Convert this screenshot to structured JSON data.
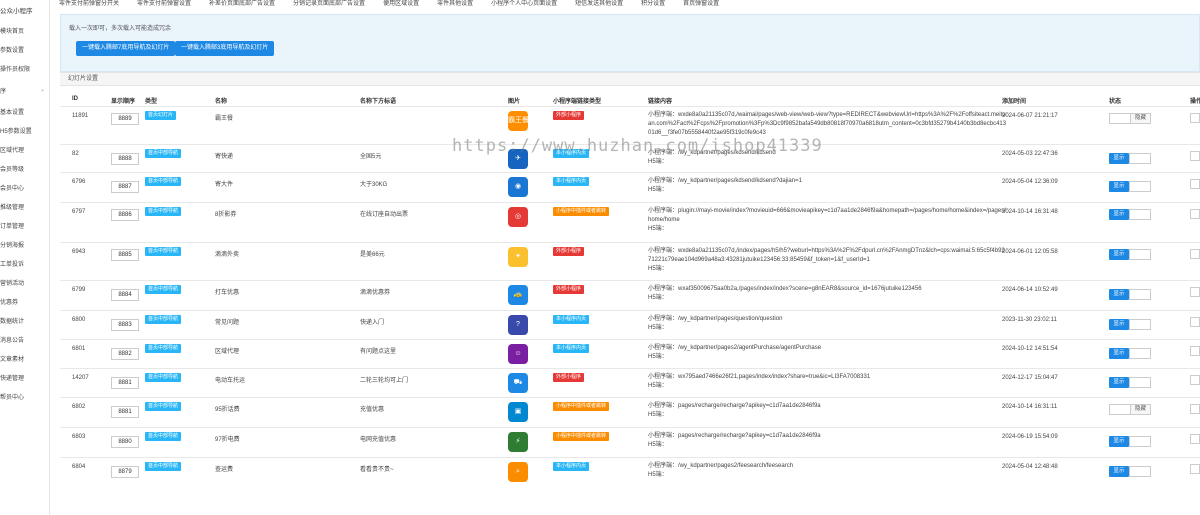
{
  "sidebar": {
    "brand": "公众小程序",
    "items": [
      "模块首页",
      "参数设置",
      "操作员权限"
    ],
    "group": "序",
    "sub_items": [
      "基本设置",
      "H5参数设置",
      "区域代理",
      "会员等级",
      "会员中心",
      "推级管理",
      "订单管理",
      "分销海报",
      "工单投诉",
      "营销活动",
      "优惠券",
      "数据统计",
      "消息公告",
      "文章素材",
      "快递管理",
      "帮员中心"
    ]
  },
  "top_tabs": [
    "零件支付前弹窗分开关",
    "零件支付前弹窗设置",
    "补差价页面底部广告设置",
    "分销记录页面底部广告设置",
    "便用区域设置",
    "零件其他设置",
    "小程序个人中心页面设置",
    "短信发送其他设置",
    "积分设置",
    "首页弹窗设置"
  ],
  "notice": {
    "message": "载入一次即可，多次载入可能造成冗余",
    "button1": "一键载入腾邮7底用导航及幻灯片",
    "button2": "一键载入腾邮3底用导航及幻灯片"
  },
  "section_title": "幻灯片设置",
  "columns": [
    "ID",
    "显示顺序",
    "类型",
    "名称",
    "名称下方标语",
    "图片",
    "小程序端链接类型",
    "链接内容",
    "添加时间",
    "状态",
    "操作"
  ],
  "watermark": "https://www.huzhan.com/ishop41339",
  "rows": [
    {
      "id": "11891",
      "order": "8889",
      "type": "首页幻灯片",
      "type_color": "cyan",
      "name": "霸王餐",
      "slogan": "",
      "icon_color": "#ff8f00",
      "icon_label": "霸王餐",
      "link_type": "外部小程序",
      "link_type_color": "red",
      "link1": "小程序端：wxde8a0a21135c07d,/waimai/pages/web-view/web-view?type=REDIRECT&webviewUrl=https%3A%2F%2Foffsiteact.meituan.com%2Fact%2Fcps%2Fpromotion%3Fp%3Dc9f9852bafa549db80818f70970a6818utm_content=0c3bfd35279b4140b3bd8ecbc41301d6__f3fe07b5558440f2ae95f319c0fe9c43",
      "link2": "",
      "time": "2024-06-07 21:21:17",
      "status": "隐藏",
      "status_on": false,
      "h": 38
    },
    {
      "id": "82",
      "order": "8888",
      "type": "首页中部导航",
      "type_color": "cyan",
      "name": "寄快递",
      "slogan": "全国5元",
      "icon_color": "#1565c0",
      "icon_label": "✈",
      "link_type": "本小程序内页",
      "link_type_color": "cyan",
      "link1": "小程序端：/wy_kdpartner/pages/kdsend/kdsend",
      "link2": "H5端：",
      "time": "2024-05-03 22:47:36",
      "status": "显示",
      "status_on": true,
      "h": 28
    },
    {
      "id": "6796",
      "order": "8887",
      "type": "首页中部导航",
      "type_color": "cyan",
      "name": "寄大件",
      "slogan": "大于30KG",
      "icon_color": "#1976d2",
      "icon_label": "◉",
      "link_type": "本小程序内页",
      "link_type_color": "cyan",
      "link1": "小程序端：/wy_kdpartner/pages/kdsend/kdsend?dajian=1",
      "link2": "H5端：",
      "time": "2024-05-04 12:36:09",
      "status": "显示",
      "status_on": true,
      "h": 30
    },
    {
      "id": "6797",
      "order": "8886",
      "type": "首页中部导航",
      "type_color": "cyan",
      "name": "8折影券",
      "slogan": "在线订座自动出票",
      "icon_color": "#e53935",
      "icon_label": "◎",
      "link_type": "小程序中插件或者跳转",
      "link_type_color": "orange",
      "link1": "小程序端：plugin://mayi-movie/index?movieuid=666&movieapikey=c1d7aa1de2846f9a&homepath=/pages/home/home&index=/pages/home/home",
      "link2": "H5端：",
      "time": "2024-10-14 16:31:48",
      "status": "显示",
      "status_on": true,
      "h": 40
    },
    {
      "id": "6943",
      "order": "8885",
      "type": "首页中部导航",
      "type_color": "cyan",
      "name": "滴滴外卖",
      "slogan": "是美66元",
      "icon_color": "#fbc02d",
      "icon_label": "✦",
      "link_type": "外部小程序",
      "link_type_color": "red",
      "link1": "小程序端：wxde8a0a21135c07d,/index/pages/h5/h5?weburl=https%3A%2F%2Fdpurl.cn%2FAnmgDTnz&lch=cps:waimai:5:65c5f4b9271221c79eae104d969a48a3:43281jutuike123456:33:85459&f_token=1&f_userId=1",
      "link2": "H5端：",
      "time": "2024-06-01 12:05:58",
      "status": "显示",
      "status_on": true,
      "h": 38
    },
    {
      "id": "6799",
      "order": "8884",
      "type": "首页中部导航",
      "type_color": "cyan",
      "name": "打车优惠",
      "slogan": "滴滴优惠券",
      "icon_color": "#1e88e5",
      "icon_label": "🚕",
      "link_type": "外部小程序",
      "link_type_color": "red",
      "link1": "小程序端：wxaf35009675aa0b2a,/pages/index/index?scene=g8nEAR8&source_id=1676jutuike123456",
      "link2": "H5端：",
      "time": "2024-06-14 10:52:49",
      "status": "显示",
      "status_on": true,
      "h": 30
    },
    {
      "id": "6800",
      "order": "8883",
      "type": "首页中部导航",
      "type_color": "cyan",
      "name": "常见问题",
      "slogan": "快递入门",
      "icon_color": "#3949ab",
      "icon_label": "?",
      "link_type": "本小程序内页",
      "link_type_color": "cyan",
      "link1": "小程序端：/wy_kdpartner/pages/question/question",
      "link2": "H5端：",
      "time": "2023-11-30 23:02:11",
      "status": "显示",
      "status_on": true,
      "h": 29
    },
    {
      "id": "6801",
      "order": "8882",
      "type": "首页中部导航",
      "type_color": "cyan",
      "name": "区域代理",
      "slogan": "有问题点这里",
      "icon_color": "#7b1fa2",
      "icon_label": "☺",
      "link_type": "本小程序内页",
      "link_type_color": "cyan",
      "link1": "小程序端：/wy_kdpartner/pages2/agentPurchase/agentPurchase",
      "link2": "H5端：",
      "time": "2024-10-12 14:51:54",
      "status": "显示",
      "status_on": true,
      "h": 29
    },
    {
      "id": "14207",
      "order": "8881",
      "type": "首页中部导航",
      "type_color": "cyan",
      "name": "电动车托运",
      "slogan": "二轮三轮均可上门",
      "icon_color": "#1e88e5",
      "icon_label": "⛟",
      "link_type": "外部小程序",
      "link_type_color": "red",
      "link1": "小程序端：wx795aed7466e26f21,pages/index/index?share=true&ic=LI3FA7008331",
      "link2": "H5端：",
      "time": "2024-12-17 15:04:47",
      "status": "显示",
      "status_on": true,
      "h": 29
    },
    {
      "id": "6802",
      "order": "8881",
      "type": "首页中部导航",
      "type_color": "cyan",
      "name": "95折话费",
      "slogan": "充值优惠",
      "icon_color": "#0288d1",
      "icon_label": "▣",
      "link_type": "小程序中插件或者跳转",
      "link_type_color": "orange",
      "link1": "小程序端：pages/recharge/recharge?apikey=c1d7aa1de2846f9a",
      "link2": "H5端：",
      "time": "2024-10-14 16:31:11",
      "status": "隐藏",
      "status_on": false,
      "h": 30
    },
    {
      "id": "6803",
      "order": "8880",
      "type": "首页中部导航",
      "type_color": "cyan",
      "name": "97折电费",
      "slogan": "电网充值优惠",
      "icon_color": "#2e7d32",
      "icon_label": "⚡",
      "link_type": "小程序中插件或者跳转",
      "link_type_color": "orange",
      "link1": "小程序端：pages/recharge/recharge?apikey=c1d7aa1de2846f9a",
      "link2": "H5端：",
      "time": "2024-06-19 15:54:09",
      "status": "显示",
      "status_on": true,
      "h": 30
    },
    {
      "id": "6804",
      "order": "8879",
      "type": "首页中部导航",
      "type_color": "cyan",
      "name": "查运费",
      "slogan": "看看贵不贵~",
      "icon_color": "#fb8c00",
      "icon_label": "⌕",
      "link_type": "本小程序内页",
      "link_type_color": "cyan",
      "link1": "小程序端：/wy_kdpartner/pages2/feesearch/feesearch",
      "link2": "H5端：",
      "time": "2024-05-04 12:48:48",
      "status": "显示",
      "status_on": true,
      "h": 30
    }
  ]
}
